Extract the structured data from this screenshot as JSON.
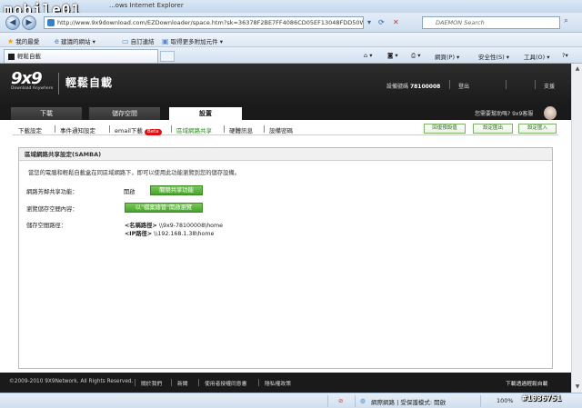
{
  "browser": {
    "title": "...ows Internet Explorer",
    "url": "http://www.9x9download.com/EZDownloader/space.htm?sk=36378F2BE7FF4086CD05EF13048FDD50WSV",
    "search_placeholder": "DAEMON Search",
    "favorites": [
      "我的最愛",
      "建議的網站 ▾",
      "自訂連結",
      "取得更多附加元件 ▾"
    ],
    "tab_label": "輕鬆自載",
    "commands": [
      "網頁(P) ▾",
      "安全性(S) ▾",
      "工具(O) ▾"
    ],
    "status_left": "網際網路 | 受保護模式: 開啟",
    "zoom": "100%",
    "watermark_left": "mobile01",
    "watermark_right": "#1036751"
  },
  "site": {
    "logo_num": "9x9",
    "logo_sub": "Download Anywhere",
    "title": "輕鬆自載",
    "device_label": "設備號碼",
    "device_id": "78100008",
    "top_links": [
      "登出",
      "支援"
    ],
    "tabs": [
      {
        "label": "下載",
        "active": false
      },
      {
        "label": "儲存空間",
        "active": false
      },
      {
        "label": "設置",
        "active": true
      }
    ],
    "help_text": "您需要幫助嗎? 9x9客服"
  },
  "subnav": {
    "items": [
      "下載設定",
      "事件通知設定",
      "email下載",
      "區域網路共享",
      "硬體訊息",
      "設備密碼"
    ],
    "beta": "Beta",
    "buttons": [
      "回復預設值",
      "設定匯出",
      "設定匯入"
    ]
  },
  "panel": {
    "title": "區域網路共享設定(SAMBA)",
    "intro": "當您的電腦和輕鬆自載盒在同區域網路下，即可以使用此功能瀏覽到您的儲存設備。",
    "rows": [
      {
        "label": "網路芳鄰共享功能：",
        "value": "開啟",
        "button": "關閉共享功能"
      },
      {
        "label": "瀏覽儲存空間內容：",
        "button": "以\"檔案總管\"開啟瀏覽"
      },
      {
        "label": "儲存空間路徑："
      }
    ],
    "paths": [
      {
        "k": "<名稱路徑>",
        "v": "\\\\9x9-78100008\\home"
      },
      {
        "k": "<IP路徑>",
        "v": "\\\\192.168.1.38\\home"
      }
    ]
  },
  "footer": {
    "copyright": "©2009-2010 9X9Network. All Rights Reserved.",
    "links": [
      "關於我們",
      "新聞",
      "使用者授權同意書",
      "隱私權政策"
    ],
    "slogan": "下載透過輕鬆自載"
  }
}
